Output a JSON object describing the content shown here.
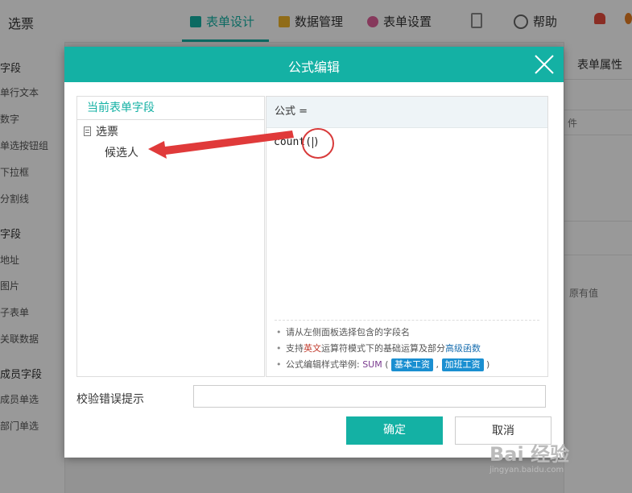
{
  "app": {
    "title": "选票",
    "tabs": [
      {
        "label": "表单设计",
        "icon": "form-design-icon",
        "active": true
      },
      {
        "label": "数据管理",
        "icon": "data-manage-icon",
        "active": false
      },
      {
        "label": "表单设置",
        "icon": "gear-icon",
        "active": false
      }
    ],
    "help_label": "帮助"
  },
  "left_panel": {
    "items": [
      {
        "label": "字段",
        "type": "head"
      },
      {
        "label": "单行文本"
      },
      {
        "label": "数字"
      },
      {
        "label": "单选按钮组"
      },
      {
        "label": "下拉框"
      },
      {
        "label": "分割线"
      },
      {
        "label": "字段",
        "type": "head"
      },
      {
        "label": "地址"
      },
      {
        "label": "图片"
      },
      {
        "label": "子表单"
      },
      {
        "label": "关联数据"
      },
      {
        "label": "成员字段",
        "type": "head"
      },
      {
        "label": "成员单选"
      },
      {
        "label": "部门单选"
      }
    ]
  },
  "right_panel": {
    "tab_label": "表单属性",
    "texts": [
      "件",
      "原有值"
    ]
  },
  "dialog": {
    "title": "公式编辑",
    "field_panel": {
      "header": "当前表单字段",
      "form_name": "选票",
      "fields": [
        "候选人"
      ]
    },
    "formula": {
      "label": "公式 =",
      "code": "count(",
      "code_close": ")",
      "tips": {
        "t1": "请从左侧面板选择包含的字段名",
        "t2_a": "支持",
        "t2_b": "英文",
        "t2_c": "运算符模式下的基础运算及部分",
        "t2_d": "高级函数",
        "t3_a": "公式编辑样式举例: ",
        "t3_fn": "SUM",
        "t3_open": " ( ",
        "t3_arg1": "基本工资",
        "t3_comma": " , ",
        "t3_arg2": "加班工资",
        "t3_close": " )"
      }
    },
    "error_label": "校验错误提示",
    "error_value": "",
    "ok_label": "确定",
    "cancel_label": "取消"
  },
  "watermark": {
    "text": "Bai 经验",
    "sub": "jingyan.baidu.com"
  },
  "colors": {
    "accent": "#14b1a4",
    "annotation": "#e03a3a",
    "chip": "#1a8fd1"
  }
}
